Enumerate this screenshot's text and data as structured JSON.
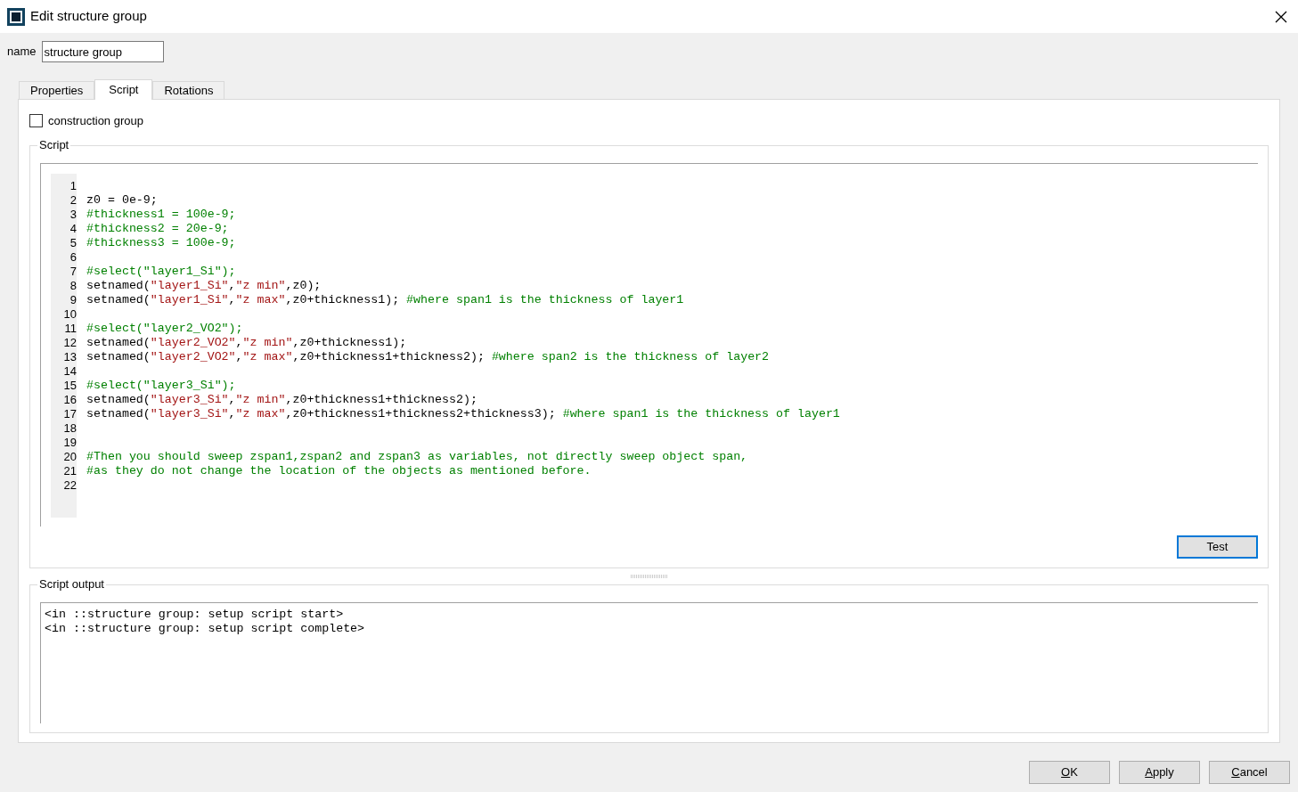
{
  "window": {
    "title": "Edit structure group"
  },
  "name_field": {
    "label": "name",
    "value": "structure group"
  },
  "tabs": [
    {
      "label": "Properties",
      "selected": false
    },
    {
      "label": "Script",
      "selected": true
    },
    {
      "label": "Rotations",
      "selected": false
    }
  ],
  "construction_group": {
    "label": "construction group",
    "checked": false
  },
  "script": {
    "title": "Script",
    "lines": [
      {
        "number": "1"
      },
      {
        "number": "2",
        "tokens": [
          {
            "kind": "code",
            "text": "z0 = 0e-9;"
          }
        ]
      },
      {
        "number": "3",
        "tokens": [
          {
            "kind": "comment",
            "text": "#thickness1 = 100e-9;"
          }
        ]
      },
      {
        "number": "4",
        "tokens": [
          {
            "kind": "comment",
            "text": "#thickness2 = 20e-9;"
          }
        ]
      },
      {
        "number": "5",
        "tokens": [
          {
            "kind": "comment",
            "text": "#thickness3 = 100e-9;"
          }
        ]
      },
      {
        "number": "6"
      },
      {
        "number": "7",
        "tokens": [
          {
            "kind": "comment",
            "text": "#select(\"layer1_Si\");"
          }
        ]
      },
      {
        "number": "8",
        "tokens": [
          {
            "kind": "code",
            "text": "setnamed("
          },
          {
            "kind": "string",
            "text": "\"layer1_Si\""
          },
          {
            "kind": "code",
            "text": ","
          },
          {
            "kind": "string",
            "text": "\"z min\""
          },
          {
            "kind": "code",
            "text": ",z0);"
          }
        ]
      },
      {
        "number": "9",
        "tokens": [
          {
            "kind": "code",
            "text": "setnamed("
          },
          {
            "kind": "string",
            "text": "\"layer1_Si\""
          },
          {
            "kind": "code",
            "text": ","
          },
          {
            "kind": "string",
            "text": "\"z max\""
          },
          {
            "kind": "code",
            "text": ",z0+thickness1); "
          },
          {
            "kind": "comment",
            "text": "#where span1 is the thickness of layer1"
          }
        ]
      },
      {
        "number": "10"
      },
      {
        "number": "11",
        "tokens": [
          {
            "kind": "comment",
            "text": "#select(\"layer2_VO2\");"
          }
        ]
      },
      {
        "number": "12",
        "tokens": [
          {
            "kind": "code",
            "text": "setnamed("
          },
          {
            "kind": "string",
            "text": "\"layer2_VO2\""
          },
          {
            "kind": "code",
            "text": ","
          },
          {
            "kind": "string",
            "text": "\"z min\""
          },
          {
            "kind": "code",
            "text": ",z0+thickness1);"
          }
        ]
      },
      {
        "number": "13",
        "tokens": [
          {
            "kind": "code",
            "text": "setnamed("
          },
          {
            "kind": "string",
            "text": "\"layer2_VO2\""
          },
          {
            "kind": "code",
            "text": ","
          },
          {
            "kind": "string",
            "text": "\"z max\""
          },
          {
            "kind": "code",
            "text": ",z0+thickness1+thickness2); "
          },
          {
            "kind": "comment",
            "text": "#where span2 is the thickness of layer2"
          }
        ]
      },
      {
        "number": "14"
      },
      {
        "number": "15",
        "tokens": [
          {
            "kind": "comment",
            "text": "#select(\"layer3_Si\");"
          }
        ]
      },
      {
        "number": "16",
        "tokens": [
          {
            "kind": "code",
            "text": "setnamed("
          },
          {
            "kind": "string",
            "text": "\"layer3_Si\""
          },
          {
            "kind": "code",
            "text": ","
          },
          {
            "kind": "string",
            "text": "\"z min\""
          },
          {
            "kind": "code",
            "text": ",z0+thickness1+thickness2);"
          }
        ]
      },
      {
        "number": "17",
        "tokens": [
          {
            "kind": "code",
            "text": "setnamed("
          },
          {
            "kind": "string",
            "text": "\"layer3_Si\""
          },
          {
            "kind": "code",
            "text": ","
          },
          {
            "kind": "string",
            "text": "\"z max\""
          },
          {
            "kind": "code",
            "text": ",z0+thickness1+thickness2+thickness3); "
          },
          {
            "kind": "comment",
            "text": "#where span1 is the thickness of layer1"
          }
        ]
      },
      {
        "number": "18"
      },
      {
        "number": "19"
      },
      {
        "number": "20",
        "tokens": [
          {
            "kind": "comment",
            "text": "#Then you should sweep zspan1,zspan2 and zspan3 as variables, not directly sweep object span,"
          }
        ]
      },
      {
        "number": "21",
        "tokens": [
          {
            "kind": "comment",
            "text": "#as they do not change the location of the objects as mentioned before."
          }
        ]
      },
      {
        "number": "22"
      }
    ],
    "test_button": "Test"
  },
  "output": {
    "title": "Script output",
    "lines": [
      "<in ::structure group: setup script start>",
      "<in ::structure group: setup script complete>"
    ]
  },
  "buttons": [
    {
      "label": "OK",
      "mnemonic": true
    },
    {
      "label": "Apply",
      "mnemonic": true
    },
    {
      "label": "Cancel",
      "mnemonic": true
    }
  ]
}
